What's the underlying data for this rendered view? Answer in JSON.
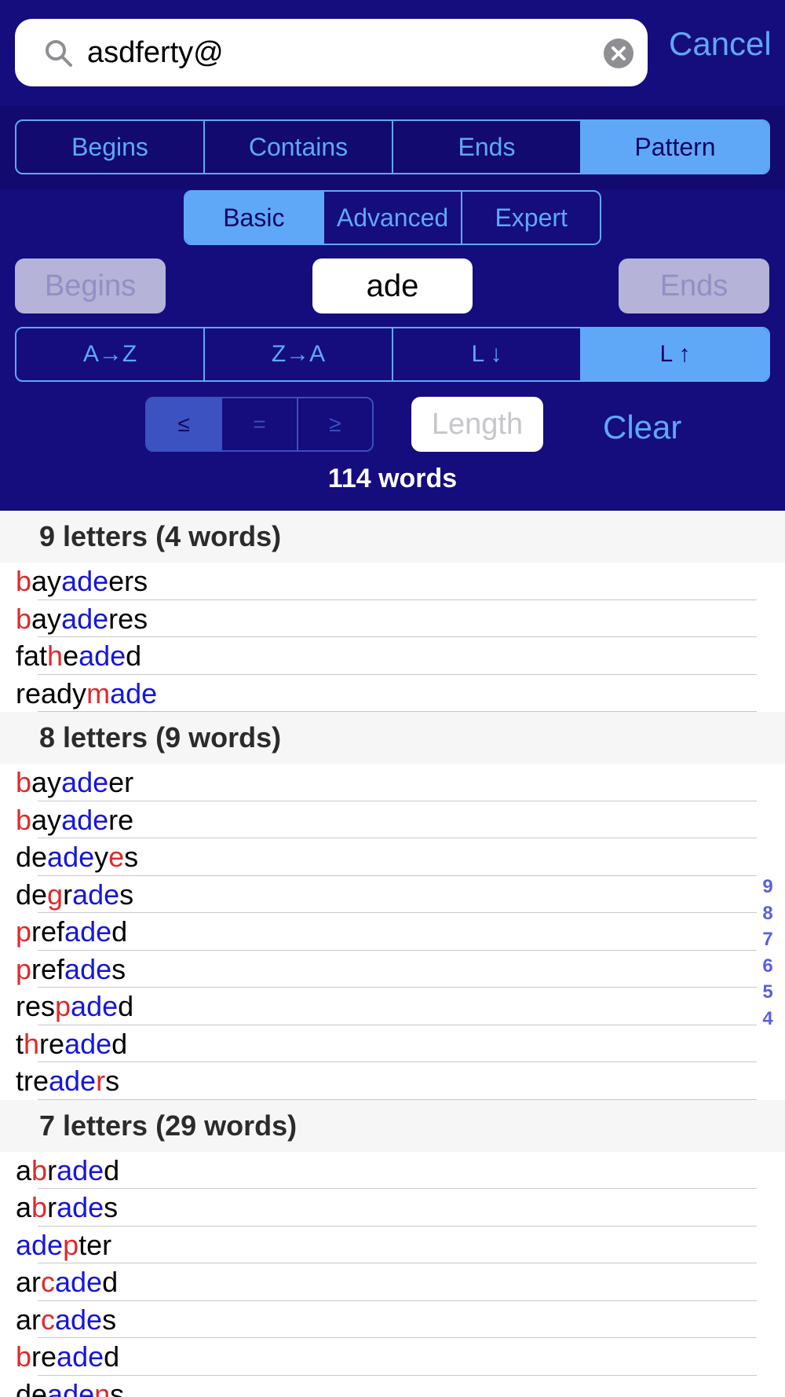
{
  "search": {
    "value": "asdferty@",
    "cancel_label": "Cancel"
  },
  "mode_tabs": [
    {
      "label": "Begins",
      "active": false
    },
    {
      "label": "Contains",
      "active": false
    },
    {
      "label": "Ends",
      "active": false
    },
    {
      "label": "Pattern",
      "active": true
    }
  ],
  "level_tabs": [
    {
      "label": "Basic",
      "active": true
    },
    {
      "label": "Advanced",
      "active": false
    },
    {
      "label": "Expert",
      "active": false
    }
  ],
  "pattern_row": {
    "begins_label": "Begins",
    "pattern_value": "ade",
    "ends_label": "Ends"
  },
  "sort_tabs": [
    {
      "label": "A→Z",
      "active": false
    },
    {
      "label": "Z→A",
      "active": false
    },
    {
      "label": "L ↓",
      "active": false
    },
    {
      "label": "L ↑",
      "active": true
    }
  ],
  "length_ops": [
    {
      "label": "≤",
      "active": true
    },
    {
      "label": "=",
      "active": false
    },
    {
      "label": "≥",
      "active": false
    }
  ],
  "length_placeholder": "Length",
  "clear_label": "Clear",
  "word_count": "114 words",
  "colors": {
    "bg": "#150c7d",
    "accent": "#5fa8f7",
    "match": "#1616de",
    "wild": "#e02a2a"
  },
  "sections": [
    {
      "header": "9 letters (4 words)",
      "words": [
        [
          [
            "b",
            "r"
          ],
          [
            "ay",
            ""
          ],
          [
            "ade",
            "b"
          ],
          [
            "ers",
            ""
          ]
        ],
        [
          [
            "b",
            "r"
          ],
          [
            "ay",
            ""
          ],
          [
            "ade",
            "b"
          ],
          [
            "res",
            ""
          ]
        ],
        [
          [
            "fat",
            ""
          ],
          [
            "h",
            "r"
          ],
          [
            "e",
            ""
          ],
          [
            "ade",
            "b"
          ],
          [
            "d",
            ""
          ]
        ],
        [
          [
            "ready",
            ""
          ],
          [
            "m",
            "r"
          ],
          [
            "ade",
            "b"
          ]
        ]
      ]
    },
    {
      "header": "8 letters (9 words)",
      "words": [
        [
          [
            "b",
            "r"
          ],
          [
            "ay",
            ""
          ],
          [
            "ade",
            "b"
          ],
          [
            "er",
            ""
          ]
        ],
        [
          [
            "b",
            "r"
          ],
          [
            "ay",
            ""
          ],
          [
            "ade",
            "b"
          ],
          [
            "re",
            ""
          ]
        ],
        [
          [
            "de",
            ""
          ],
          [
            "ade",
            "b"
          ],
          [
            "y",
            ""
          ],
          [
            "e",
            "r"
          ],
          [
            "s",
            ""
          ]
        ],
        [
          [
            "de",
            ""
          ],
          [
            "g",
            "r"
          ],
          [
            "r",
            ""
          ],
          [
            "ade",
            "b"
          ],
          [
            "s",
            ""
          ]
        ],
        [
          [
            "p",
            "r"
          ],
          [
            "ref",
            ""
          ],
          [
            "ade",
            "b"
          ],
          [
            "d",
            ""
          ]
        ],
        [
          [
            "p",
            "r"
          ],
          [
            "ref",
            ""
          ],
          [
            "ade",
            "b"
          ],
          [
            "s",
            ""
          ]
        ],
        [
          [
            "res",
            ""
          ],
          [
            "p",
            "r"
          ],
          [
            "ade",
            "b"
          ],
          [
            "d",
            ""
          ]
        ],
        [
          [
            "t",
            ""
          ],
          [
            "h",
            "r"
          ],
          [
            "re",
            ""
          ],
          [
            "ade",
            "b"
          ],
          [
            "d",
            ""
          ]
        ],
        [
          [
            "tre",
            ""
          ],
          [
            "ade",
            "b"
          ],
          [
            "r",
            "r"
          ],
          [
            "s",
            ""
          ]
        ]
      ]
    },
    {
      "header": "7 letters (29 words)",
      "words": [
        [
          [
            "a",
            ""
          ],
          [
            "b",
            "r"
          ],
          [
            "r",
            ""
          ],
          [
            "ade",
            "b"
          ],
          [
            "d",
            ""
          ]
        ],
        [
          [
            "a",
            ""
          ],
          [
            "b",
            "r"
          ],
          [
            "r",
            ""
          ],
          [
            "ade",
            "b"
          ],
          [
            "s",
            ""
          ]
        ],
        [
          [
            "ade",
            "b"
          ],
          [
            "p",
            "r"
          ],
          [
            "ter",
            ""
          ]
        ],
        [
          [
            "ar",
            ""
          ],
          [
            "c",
            "r"
          ],
          [
            "ade",
            "b"
          ],
          [
            "d",
            ""
          ]
        ],
        [
          [
            "ar",
            ""
          ],
          [
            "c",
            "r"
          ],
          [
            "ade",
            "b"
          ],
          [
            "s",
            ""
          ]
        ],
        [
          [
            "b",
            "r"
          ],
          [
            "re",
            ""
          ],
          [
            "ade",
            "b"
          ],
          [
            "d",
            ""
          ]
        ],
        [
          [
            "de",
            ""
          ],
          [
            "ade",
            "b"
          ],
          [
            "n",
            "r"
          ],
          [
            "s",
            ""
          ]
        ]
      ]
    }
  ],
  "index": [
    "9",
    "8",
    "7",
    "6",
    "5",
    "4"
  ]
}
